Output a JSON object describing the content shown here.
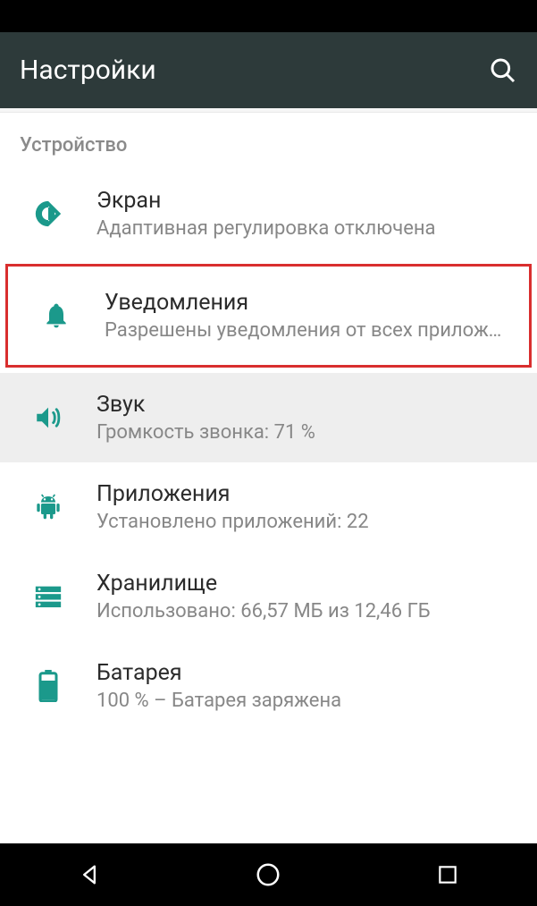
{
  "header": {
    "title": "Настройки"
  },
  "section": {
    "title": "Устройство"
  },
  "items": [
    {
      "icon": "display",
      "title": "Экран",
      "subtitle": "Адаптивная регулировка отключена"
    },
    {
      "icon": "bell",
      "title": "Уведомления",
      "subtitle": "Разрешены уведомления от всех приложе…"
    },
    {
      "icon": "volume",
      "title": "Звук",
      "subtitle": "Громкость звонка: 71 %"
    },
    {
      "icon": "apps",
      "title": "Приложения",
      "subtitle": "Установлено приложений: 22"
    },
    {
      "icon": "storage",
      "title": "Хранилище",
      "subtitle": "Использовано: 66,57 МБ из 12,46 ГБ"
    },
    {
      "icon": "battery",
      "title": "Батарея",
      "subtitle": "100 % – Батарея заряжена"
    }
  ],
  "colors": {
    "accent": "#1b998b"
  }
}
